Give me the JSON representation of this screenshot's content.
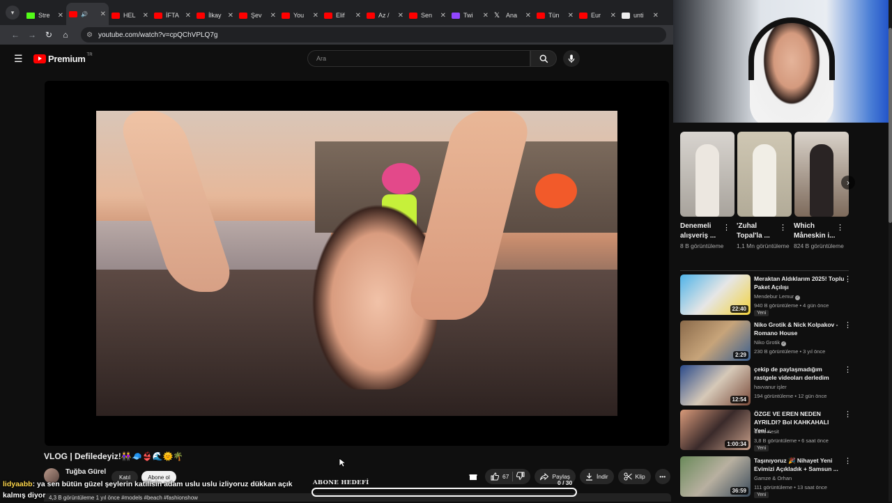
{
  "browser": {
    "tabs": [
      {
        "label": "Stre",
        "icon": "kick-icon"
      },
      {
        "label": "",
        "icon": "youtube-icon",
        "active": true
      },
      {
        "label": "HEL",
        "icon": "youtube-icon"
      },
      {
        "label": "İFTA",
        "icon": "youtube-icon"
      },
      {
        "label": "İlkay",
        "icon": "youtube-icon"
      },
      {
        "label": "Şev",
        "icon": "youtube-icon"
      },
      {
        "label": "You",
        "icon": "youtube-icon"
      },
      {
        "label": "Elif",
        "icon": "youtube-icon"
      },
      {
        "label": "Az /",
        "icon": "youtube-icon"
      },
      {
        "label": "Sen",
        "icon": "youtube-icon"
      },
      {
        "label": "Twi",
        "icon": "twitch-icon"
      },
      {
        "label": "Ana",
        "icon": "x-icon"
      },
      {
        "label": "Tün",
        "icon": "youtube-icon"
      },
      {
        "label": "Eur",
        "icon": "youtube-icon"
      },
      {
        "label": "unti",
        "icon": "doc-icon"
      }
    ],
    "url": "youtube.com/watch?v=cpQChVPLQ7g"
  },
  "header": {
    "logo_text": "Premium",
    "logo_country": "TR",
    "search_placeholder": "Ara"
  },
  "video": {
    "title": "VLOG | Defiledeyiz!👭🧢👙🌊🌞🌴",
    "channel": "Tuğba Gürel",
    "join_label": "Katıl",
    "subscribe_label": "Abone ol",
    "meta_line": "4,3 B görüntüleme  1 yıl önce  #models #beach #fashionshow",
    "like_count": "67",
    "share_label": "Paylaş",
    "download_label": "İndir",
    "clip_label": "Klip"
  },
  "overlay": {
    "chat_user": "lidyaabb",
    "chat_message": ": ya sen bütün güzel şeylerin katilisin adam uslu uslu izliyoruz dükkan açık kalmış diyor",
    "goal_label": "ABONE HEDEFİ",
    "goal_count": "0 / 30",
    "goal_progress": 0
  },
  "shorts": [
    {
      "title": "Denemeli alışveriş ...",
      "views": "8 B görüntüleme"
    },
    {
      "title": "'Zuhal Topal'la ...",
      "views": "1,1 Mn görüntüleme"
    },
    {
      "title": "Which Måneskin i...",
      "views": "824 B görüntüleme"
    }
  ],
  "recommendations": [
    {
      "title": "Meraktan Aldıklarım 2025! Toplu Paket Açılışı",
      "channel": "Mendebur Lemur",
      "verified": true,
      "views": "940 B görüntüleme • 4 gün önce",
      "duration": "22:40",
      "badge": "Yeni"
    },
    {
      "title": "Niko Grotik & Nick Kolpakov - Romano House",
      "channel": "Niko Grotik",
      "verified": true,
      "views": "230 B görüntüleme • 3 yıl önce",
      "duration": "2:29",
      "badge": ""
    },
    {
      "title": "çekip de paylaşmadığım rastgele videoları derledim",
      "channel": "havvanur işler",
      "verified": false,
      "views": "194 görüntüleme • 12 gün önce",
      "duration": "12:54",
      "badge": ""
    },
    {
      "title": "ÖZGE VE EREN NEDEN AYRILDI? Bol KAHKAHALI Yeni...",
      "channel": "Cavs Kesit",
      "verified": false,
      "views": "3,8 B görüntüleme • 6 saat önce",
      "duration": "1:00:34",
      "badge": "Yeni"
    },
    {
      "title": "Taşınıyoruz 🎉 Nihayet Yeni Evimizi Açıkladık + Samsun ...",
      "channel": "Gamze & Orhan",
      "verified": false,
      "views": "111 görüntüleme • 13 saat önce",
      "duration": "36:59",
      "badge": "Yeni"
    }
  ]
}
